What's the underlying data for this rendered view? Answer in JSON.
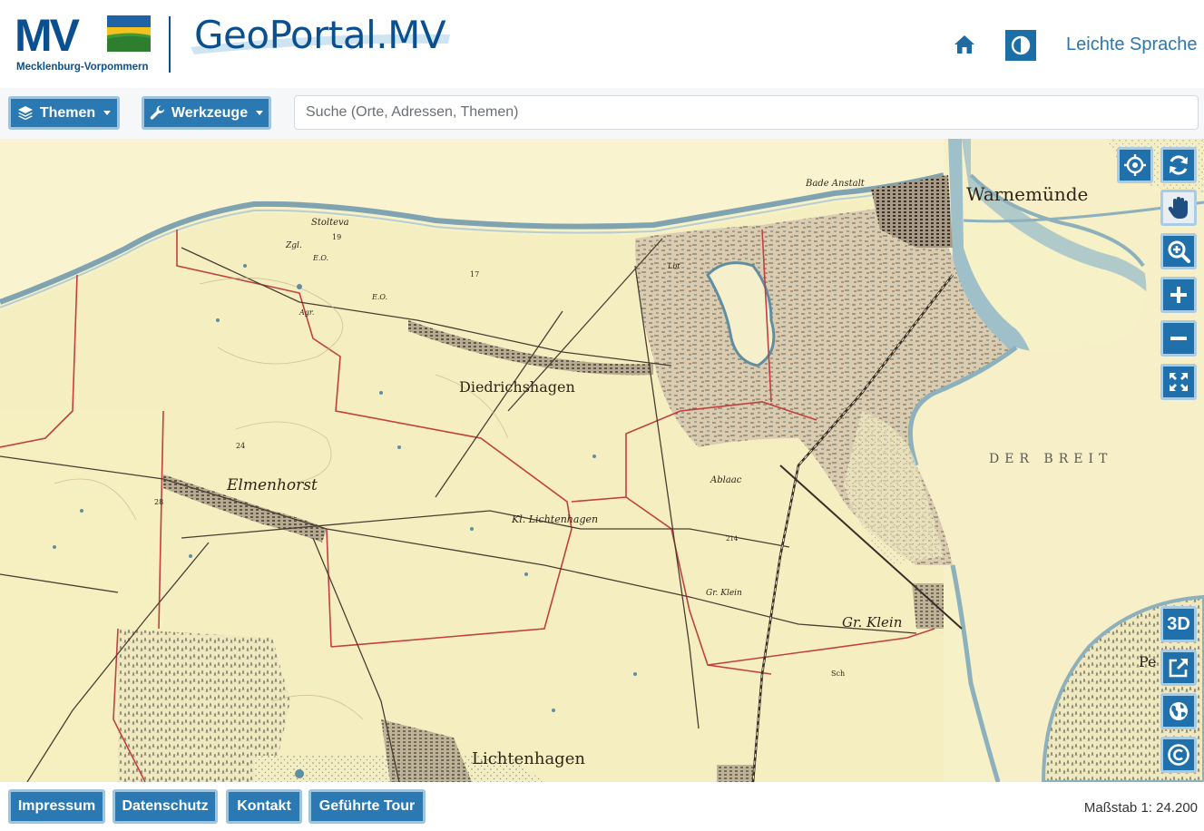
{
  "header": {
    "logo_letters": "MV",
    "logo_state": "Mecklenburg-Vorpommern",
    "portal_title": "GeoPortal.MV",
    "home_icon": "home-icon",
    "contrast_icon": "contrast-icon",
    "easy_language": "Leichte Sprache"
  },
  "toolbar": {
    "themes_label": "Themen",
    "themes_icon": "layers-icon",
    "tools_label": "Werkzeuge",
    "tools_icon": "wrench-icon",
    "search_placeholder": "Suche (Orte, Adressen, Themen)"
  },
  "map": {
    "labels": {
      "warnemuende": "Warnemünde",
      "bade_anstalt": "Bade Anstalt",
      "diedrichshagen": "Diedrichshagen",
      "elmenhorst": "Elmenhorst",
      "kl_lichtenhagen": "Kl. Lichtenhagen",
      "gr_klein": "Gr. Klein",
      "gr_klein_small": "Gr. Klein",
      "lichtenhagen": "Lichtenhagen",
      "ablaac": "Ablaac",
      "breit": "DER   BREIT",
      "pe": "Pe",
      "stolteva": "Stolteva",
      "zgl": "Zgl.",
      "eo1": "E.O.",
      "eo2": "E.O.",
      "agr": "Agr.",
      "n19": "19",
      "n17": "17",
      "n24": "24",
      "n28": "28",
      "n214": "214",
      "sch": "Sch",
      "lbt": "Lbt"
    },
    "controls": {
      "locate": "crosshair-icon",
      "refresh": "refresh-icon",
      "pan": "hand-icon",
      "zoom_box": "zoom-box-icon",
      "zoom_in": "plus-icon",
      "zoom_out": "minus-icon",
      "fullscreen": "fullscreen-icon",
      "three_d_label": "3D",
      "external": "external-link-icon",
      "globe": "globe-icon",
      "copyright": "copyright-icon"
    }
  },
  "footer": {
    "impressum": "Impressum",
    "datenschutz": "Datenschutz",
    "kontakt": "Kontakt",
    "tour": "Geführte Tour",
    "scale": "Maßstab 1: 24.200"
  },
  "colors": {
    "brand_blue": "#0a4f8f",
    "button_blue": "#2b79b3",
    "map_paper": "#f6f1c6",
    "water": "#9fbfc9"
  }
}
